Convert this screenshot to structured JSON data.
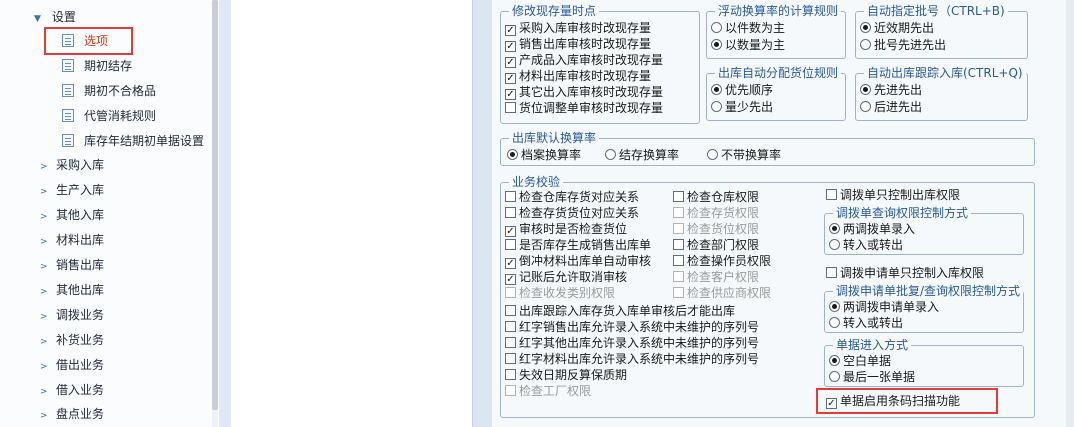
{
  "tree": {
    "settings": {
      "label": "设置"
    },
    "children": [
      "选项",
      "期初结存",
      "期初不合格品",
      "代管消耗规则",
      "库存年结期初单据设置"
    ],
    "groups": [
      "采购入库",
      "生产入库",
      "其他入库",
      "材料出库",
      "销售出库",
      "其他出库",
      "调拨业务",
      "补货业务",
      "借出业务",
      "借入业务",
      "盘点业务"
    ]
  },
  "modify_stock": {
    "title": "修改现存量时点",
    "items": [
      {
        "label": "采购入库审核时改现存量",
        "checked": true,
        "enabled": true
      },
      {
        "label": "销售出库审核时改现存量",
        "checked": true,
        "enabled": true
      },
      {
        "label": "产成品入库审核时改现存量",
        "checked": true,
        "enabled": true
      },
      {
        "label": "材料出库审核时改现存量",
        "checked": true,
        "enabled": true
      },
      {
        "label": "其它出入库审核时改现存量",
        "checked": true,
        "enabled": true
      },
      {
        "label": "货位调整单审核时改现存量",
        "checked": false,
        "enabled": true
      }
    ]
  },
  "float_rate": {
    "title": "浮动换算率的计算规则",
    "options": [
      {
        "label": "以件数为主",
        "selected": false
      },
      {
        "label": "以数量为主",
        "selected": true
      }
    ]
  },
  "auto_batch": {
    "title": "自动指定批号（CTRL+B)",
    "options": [
      {
        "label": "近效期先出",
        "selected": true
      },
      {
        "label": "批号先进先出",
        "selected": false
      }
    ]
  },
  "auto_location": {
    "title": "出库自动分配货位规则",
    "options": [
      {
        "label": "优先顺序",
        "selected": true
      },
      {
        "label": "量少先出",
        "selected": false
      }
    ]
  },
  "auto_trace": {
    "title": "自动出库跟踪入库(CTRL+Q)",
    "options": [
      {
        "label": "先进先出",
        "selected": true
      },
      {
        "label": "后进先出",
        "selected": false
      }
    ]
  },
  "default_rate": {
    "title": "出库默认换算率",
    "options": [
      {
        "label": "档案换算率",
        "selected": true
      },
      {
        "label": "结存换算率",
        "selected": false
      },
      {
        "label": "不带换算率",
        "selected": false
      }
    ]
  },
  "business": {
    "title": "业务校验",
    "col1": [
      {
        "label": "检查仓库存货对应关系",
        "checked": false,
        "enabled": true
      },
      {
        "label": "检查存货货位对应关系",
        "checked": false,
        "enabled": true
      },
      {
        "label": "审核时是否检查货位",
        "checked": true,
        "enabled": true
      },
      {
        "label": "是否库存生成销售出库单",
        "checked": false,
        "enabled": true
      },
      {
        "label": "倒冲材料出库单自动审核",
        "checked": true,
        "enabled": true
      },
      {
        "label": "记账后允许取消审核",
        "checked": true,
        "enabled": true
      },
      {
        "label": "检查收发类别权限",
        "checked": false,
        "enabled": false
      }
    ],
    "col2": [
      {
        "label": "检查仓库权限",
        "checked": false,
        "enabled": true
      },
      {
        "label": "检查存货权限",
        "checked": false,
        "enabled": false
      },
      {
        "label": "检查货位权限",
        "checked": false,
        "enabled": false
      },
      {
        "label": "检查部门权限",
        "checked": false,
        "enabled": true
      },
      {
        "label": "检查操作员权限",
        "checked": false,
        "enabled": true
      },
      {
        "label": "检查客户权限",
        "checked": false,
        "enabled": false
      },
      {
        "label": "检查供应商权限",
        "checked": false,
        "enabled": false
      }
    ],
    "wide": [
      {
        "label": "出库跟踪入库存货入库单审核后才能出库",
        "checked": false,
        "enabled": true
      },
      {
        "label": "红字销售出库允许录入系统中未维护的序列号",
        "checked": false,
        "enabled": true
      },
      {
        "label": "红字其他出库允许录入系统中未维护的序列号",
        "checked": false,
        "enabled": true
      },
      {
        "label": "红字材料出库允许录入系统中未维护的序列号",
        "checked": false,
        "enabled": true
      },
      {
        "label": "失效日期反算保质期",
        "checked": false,
        "enabled": true
      },
      {
        "label": "检查工厂权限",
        "checked": false,
        "enabled": false
      }
    ]
  },
  "transfer": {
    "only_out_label": "调拨单只控制出库权限",
    "only_out_checked": false,
    "control": {
      "title": "调拨单查询权限控制方式",
      "options": [
        {
          "label": "两调拨单录入",
          "selected": true
        },
        {
          "label": "转入或转出",
          "selected": false
        }
      ]
    },
    "apply_only_out_label": "调拨申请单只控制入库权限",
    "apply_only_out_checked": false,
    "apply_control": {
      "title": "调拨申请单批复/查询权限控制方式",
      "options": [
        {
          "label": "两调拨申请单录入",
          "selected": true
        },
        {
          "label": "转入或转出",
          "selected": false
        }
      ]
    }
  },
  "doc_entry": {
    "title": "单据进入方式",
    "options": [
      {
        "label": "空白单据",
        "selected": true
      },
      {
        "label": "最后一张单据",
        "selected": false
      }
    ]
  },
  "barcode": {
    "label": "单据启用条码扫描功能",
    "checked": true
  },
  "colors": {
    "highlight": "#e23b3b",
    "group_title": "#2a5b9a",
    "selected_text": "#d23c1c"
  }
}
